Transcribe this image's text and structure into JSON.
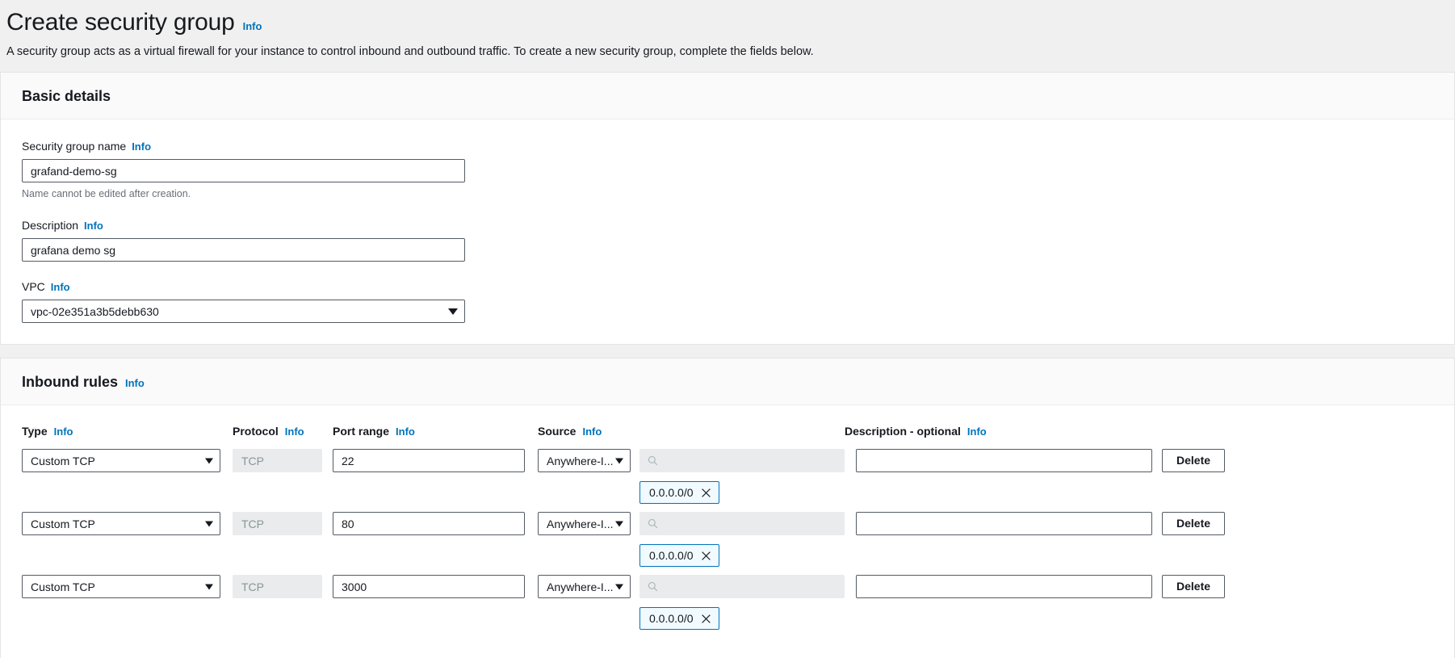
{
  "header": {
    "title": "Create security group",
    "info_label": "Info",
    "description": "A security group acts as a virtual firewall for your instance to control inbound and outbound traffic. To create a new security group, complete the fields below."
  },
  "basic_details": {
    "section_title": "Basic details",
    "name_label": "Security group name",
    "name_info": "Info",
    "name_value": "grafand-demo-sg",
    "name_hint": "Name cannot be edited after creation.",
    "description_label": "Description",
    "description_info": "Info",
    "description_value": "grafana demo sg",
    "vpc_label": "VPC",
    "vpc_info": "Info",
    "vpc_value": "vpc-02e351a3b5debb630"
  },
  "inbound_rules": {
    "section_title": "Inbound rules",
    "section_info": "Info",
    "columns": [
      {
        "label": "Type",
        "info": "Info"
      },
      {
        "label": "Protocol",
        "info": "Info"
      },
      {
        "label": "Port range",
        "info": "Info"
      },
      {
        "label": "Source",
        "info": "Info"
      },
      {
        "label": "Description - optional",
        "info": "Info"
      }
    ],
    "search_placeholder": "",
    "delete_label": "Delete",
    "rows": [
      {
        "type": "Custom TCP",
        "protocol": "TCP",
        "port": "22",
        "source_scope": "Anywhere-I...",
        "source_search": "",
        "cidr": "0.0.0.0/0",
        "description": "",
        "delete": "Delete"
      },
      {
        "type": "Custom TCP",
        "protocol": "TCP",
        "port": "80",
        "source_scope": "Anywhere-I...",
        "source_search": "",
        "cidr": "0.0.0.0/0",
        "description": "",
        "delete": "Delete"
      },
      {
        "type": "Custom TCP",
        "protocol": "TCP",
        "port": "3000",
        "source_scope": "Anywhere-I...",
        "source_search": "",
        "cidr": "0.0.0.0/0",
        "description": "",
        "delete": "Delete"
      }
    ]
  },
  "colors": {
    "page_bg": "#f0f0f0",
    "card_bg": "#ffffff",
    "card_header_bg": "#fafafa",
    "link": "#0073bb",
    "border": "#545b64",
    "disabled_bg": "#e9ebed",
    "token_bg": "#f1faff",
    "token_border": "#0073bb",
    "text": "#16191f",
    "muted": "#687078"
  }
}
